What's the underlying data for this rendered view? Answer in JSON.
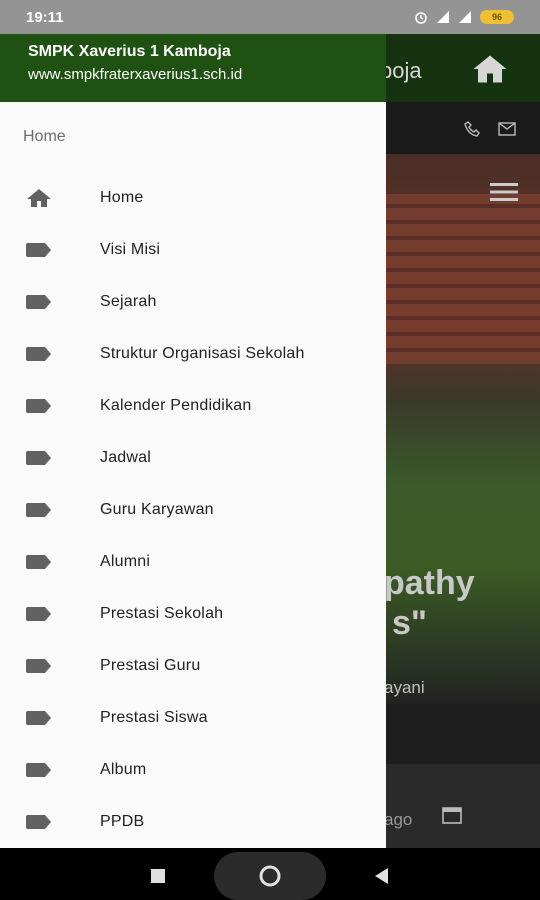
{
  "status_bar": {
    "time": "19:11",
    "battery": "96"
  },
  "background_app": {
    "title_fragment": "boja",
    "hero_text_1": "pathy",
    "hero_text_2": "s\"",
    "hero_text_3": "ayani",
    "bottom_text": "ago"
  },
  "drawer": {
    "title": "SMPK Xaverius 1 Kamboja",
    "subtitle": "www.smpkfraterxaverius1.sch.id",
    "section_label": "Home",
    "items": [
      {
        "label": "Home",
        "icon": "home-icon"
      },
      {
        "label": "Visi Misi",
        "icon": "label-icon"
      },
      {
        "label": "Sejarah",
        "icon": "label-icon"
      },
      {
        "label": "Struktur Organisasi Sekolah",
        "icon": "label-icon"
      },
      {
        "label": "Kalender Pendidikan",
        "icon": "label-icon"
      },
      {
        "label": "Jadwal",
        "icon": "label-icon"
      },
      {
        "label": "Guru Karyawan",
        "icon": "label-icon"
      },
      {
        "label": "Alumni",
        "icon": "label-icon"
      },
      {
        "label": "Prestasi Sekolah",
        "icon": "label-icon"
      },
      {
        "label": "Prestasi Guru",
        "icon": "label-icon"
      },
      {
        "label": "Prestasi Siswa",
        "icon": "label-icon"
      },
      {
        "label": "Album",
        "icon": "label-icon"
      },
      {
        "label": "PPDB",
        "icon": "label-icon"
      }
    ]
  },
  "colors": {
    "drawer_header": "#1f5212",
    "icon_gray": "#616161"
  }
}
